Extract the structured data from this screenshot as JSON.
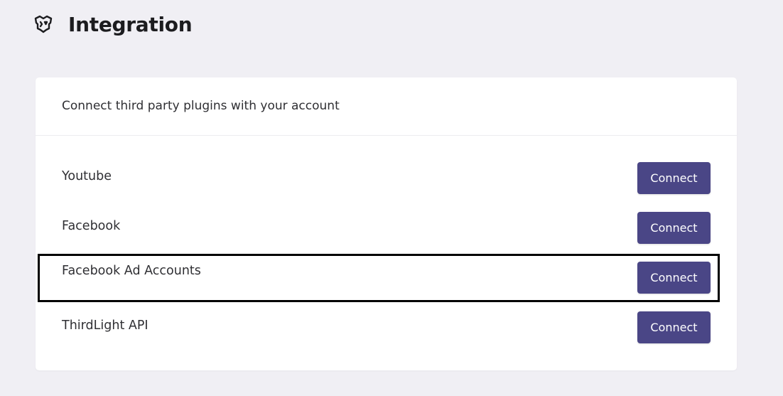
{
  "header": {
    "title": "Integration",
    "icon": "puzzle-integration-icon"
  },
  "card": {
    "subtitle": "Connect third party plugins with your account"
  },
  "integrations": [
    {
      "name": "Youtube",
      "button_label": "Connect"
    },
    {
      "name": "Facebook",
      "button_label": "Connect"
    },
    {
      "name": "Facebook Ad Accounts",
      "button_label": "Connect",
      "highlighted": true
    },
    {
      "name": "ThirdLight API",
      "button_label": "Connect"
    }
  ],
  "colors": {
    "background": "#f0eff4",
    "card": "#ffffff",
    "button": "#4a4686",
    "button_text": "#ffffff",
    "highlight_border": "#000000"
  }
}
